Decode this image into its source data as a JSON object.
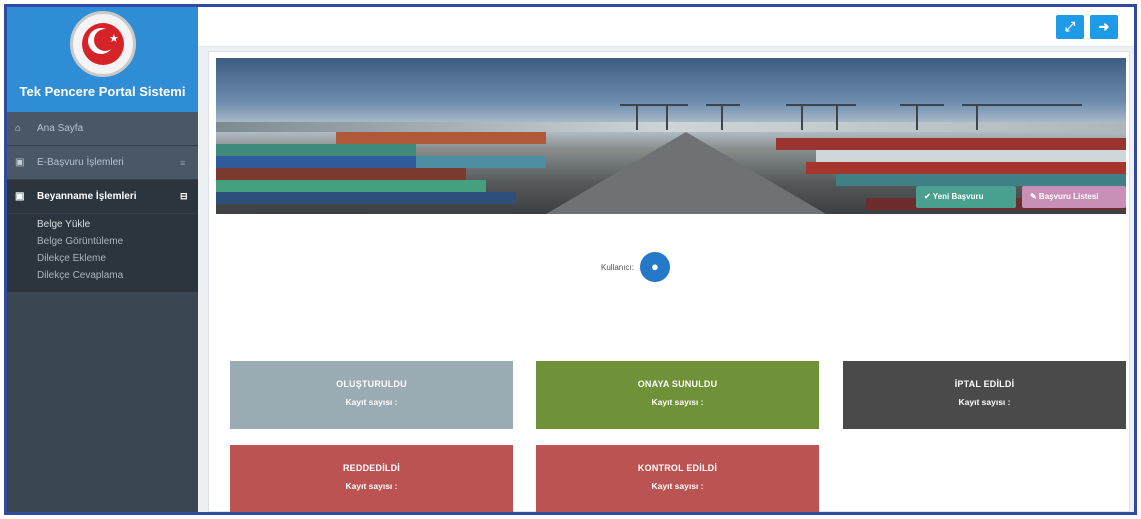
{
  "sidebar": {
    "brand_title": "Tek Pencere Portal Sistemi",
    "menu": [
      {
        "icon": "home-icon",
        "glyph": "⌂",
        "label": "Ana Sayfa",
        "caret": ""
      },
      {
        "icon": "picture-icon",
        "glyph": "▣",
        "label": "E-Başvuru İşlemleri",
        "caret": "≡"
      },
      {
        "icon": "picture-icon",
        "glyph": "▣",
        "label": "Beyanname İşlemleri",
        "caret": "⊟"
      }
    ],
    "submenu": [
      "Belge Yükle",
      "Belge Görüntüleme",
      "Dilekçe Ekleme",
      "Dilekçe Cevaplama"
    ]
  },
  "topbar": {
    "fullscreen_glyph": "⤢",
    "logout_glyph": "➜"
  },
  "banner": {
    "new_application_label": "✔ Yeni Başvuru",
    "application_list_label": "✎ Başvuru Listesi"
  },
  "user": {
    "label": "Kullanıcı:",
    "avatar_glyph": "●"
  },
  "status_cards": [
    {
      "title": "OLUŞTURULDU",
      "count_label": "Kayıt sayısı :",
      "color": "#9aabb3"
    },
    {
      "title": "ONAYA SUNULDU",
      "count_label": "Kayıt sayısı :",
      "color": "#6f9137"
    },
    {
      "title": "İPTAL EDİLDİ",
      "count_label": "Kayıt sayısı :",
      "color": "#4a4a4a"
    },
    {
      "title": "REDDEDİLDİ",
      "count_label": "Kayıt sayısı :",
      "color": "#bb5352"
    },
    {
      "title": "KONTROL EDİLDİ",
      "count_label": "Kayıt sayısı :",
      "color": "#bb5352"
    }
  ],
  "colors": {
    "brand_blue": "#2f8dd5",
    "sidebar": "#3a4753",
    "topbar_button": "#1e9be6"
  }
}
